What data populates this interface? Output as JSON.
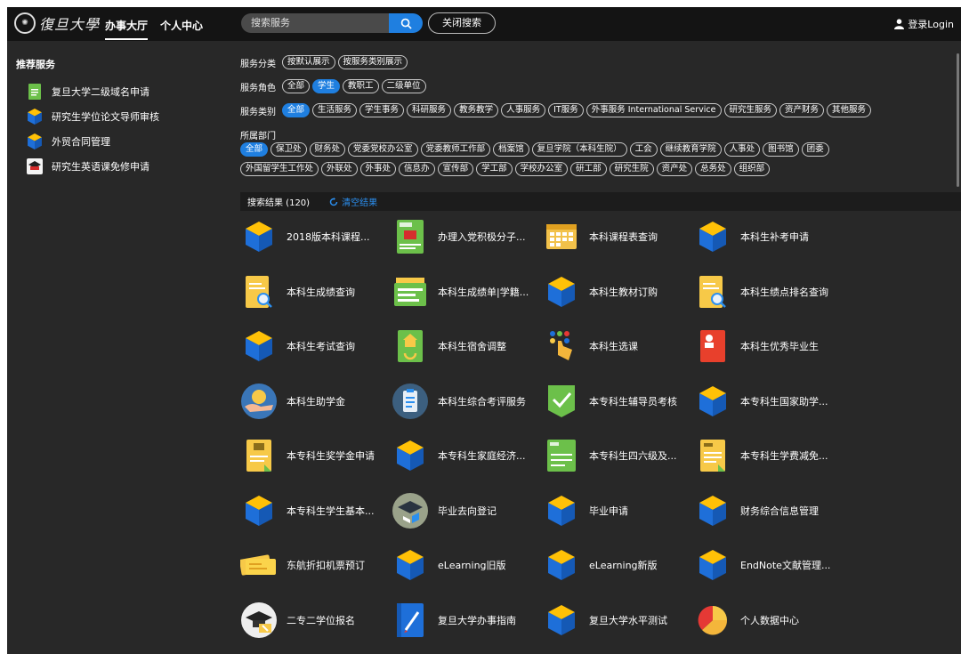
{
  "header": {
    "logo_text": "復旦大學",
    "nav": [
      "办事大厅",
      "个人中心"
    ],
    "search_placeholder": "搜索服务",
    "close_search": "关闭搜索",
    "login": "登录Login"
  },
  "sidebar": {
    "title": "推荐服务",
    "items": [
      {
        "label": "复旦大学二级域名申请",
        "icon": "green-document-icon"
      },
      {
        "label": "研究生学位论文导师审核",
        "icon": "cube-icon"
      },
      {
        "label": "外贸合同管理",
        "icon": "cube-icon"
      },
      {
        "label": "研究生英语课免修申请",
        "icon": "graduation-icon"
      }
    ]
  },
  "filters": {
    "classification": {
      "label": "服务分类",
      "options": [
        "按默认展示",
        "按服务类别展示"
      ]
    },
    "role": {
      "label": "服务角色",
      "options": [
        "全部",
        "学生",
        "教职工",
        "二级单位"
      ],
      "selected": "学生"
    },
    "category": {
      "label": "服务类别",
      "options": [
        "全部",
        "生活服务",
        "学生事务",
        "科研服务",
        "教务教学",
        "人事服务",
        "IT服务",
        "外事服务 International Service",
        "研究生服务",
        "资产财务",
        "其他服务"
      ],
      "selected": "全部"
    },
    "department": {
      "label": "所属部门",
      "row1": [
        "全部",
        "保卫处",
        "财务处",
        "党委党校办公室",
        "党委教师工作部",
        "档案馆",
        "复旦学院（本科生院）",
        "工会",
        "继续教育学院",
        "人事处",
        "图书馆",
        "团委"
      ],
      "row2": [
        "外国留学生工作处",
        "外联处",
        "外事处",
        "信息办",
        "宣传部",
        "学工部",
        "学校办公室",
        "研工部",
        "研究生院",
        "资产处",
        "总务处",
        "组织部"
      ],
      "selected": "全部"
    }
  },
  "results": {
    "count_label": "搜索结果 (120)",
    "clear_label": "清空结果",
    "tiles": [
      {
        "label": "2018版本科课程...",
        "icon": "cube-icon"
      },
      {
        "label": "办理入党积极分子...",
        "icon": "party-certificate-icon"
      },
      {
        "label": "本科课程表查询",
        "icon": "calendar-icon"
      },
      {
        "label": "本科生补考申请",
        "icon": "cube-icon"
      },
      {
        "label": "本科生成绩查询",
        "icon": "grade-search-icon"
      },
      {
        "label": "本科生成绩单|学籍...",
        "icon": "transcript-icon"
      },
      {
        "label": "本科生教材订购",
        "icon": "cube-icon"
      },
      {
        "label": "本科生绩点排名查询",
        "icon": "grade-search-icon"
      },
      {
        "label": "本科生考试查询",
        "icon": "cube-icon"
      },
      {
        "label": "本科生宿舍调整",
        "icon": "dorm-icon"
      },
      {
        "label": "本科生选课",
        "icon": "hand-select-icon"
      },
      {
        "label": "本科生优秀毕业生",
        "icon": "graduate-badge-icon"
      },
      {
        "label": "本科生助学金",
        "icon": "coin-hand-icon"
      },
      {
        "label": "本科生综合考评服务",
        "icon": "clipboard-icon"
      },
      {
        "label": "本专科生辅导员考核",
        "icon": "checkmark-icon"
      },
      {
        "label": "本专科生国家助学...",
        "icon": "cube-icon"
      },
      {
        "label": "本专科生奖学金申请",
        "icon": "trophy-doc-icon"
      },
      {
        "label": "本专科生家庭经济...",
        "icon": "cube-icon"
      },
      {
        "label": "本专科生四六级及...",
        "icon": "exam-doc-icon"
      },
      {
        "label": "本专科生学费减免...",
        "icon": "fee-doc-icon"
      },
      {
        "label": "本专科生学生基本...",
        "icon": "cube-icon"
      },
      {
        "label": "毕业去向登记",
        "icon": "graduation-go-icon"
      },
      {
        "label": "毕业申请",
        "icon": "cube-icon"
      },
      {
        "label": "财务综合信息管理",
        "icon": "cube-icon"
      },
      {
        "label": "东航折扣机票预订",
        "icon": "ticket-icon"
      },
      {
        "label": "eLearning旧版",
        "icon": "cube-icon"
      },
      {
        "label": "eLearning新版",
        "icon": "cube-icon"
      },
      {
        "label": "EndNote文献管理...",
        "icon": "cube-icon"
      },
      {
        "label": "二专二学位报名",
        "icon": "graduation-cap-icon"
      },
      {
        "label": "复旦大学办事指南",
        "icon": "guide-book-icon"
      },
      {
        "label": "复旦大学水平测试",
        "icon": "cube-icon"
      },
      {
        "label": "个人数据中心",
        "icon": "pie-chart-icon"
      }
    ]
  },
  "colors": {
    "accent": "#1f7fe0",
    "panel": "#282828",
    "topbar": "#141414"
  }
}
